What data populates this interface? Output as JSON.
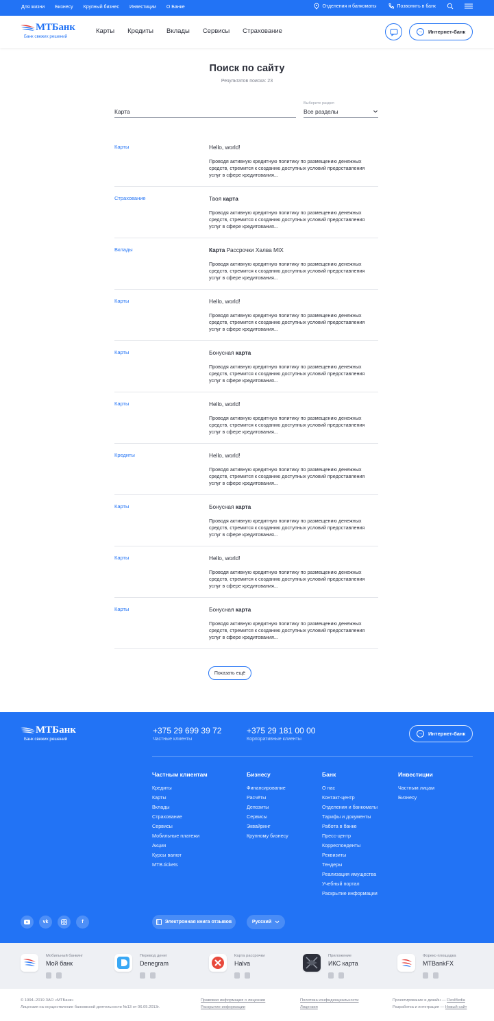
{
  "topbar": {
    "links": [
      "Для жизни",
      "Бизнесу",
      "Крупный бизнес",
      "Инвестиции",
      "О Банке"
    ],
    "branches": "Отделения и банкоматы",
    "call": "Позвонить в банк"
  },
  "header": {
    "logo_text": "МТБанк",
    "logo_slogan": "Банк свежих решений",
    "nav": [
      "Карты",
      "Кредиты",
      "Вклады",
      "Сервисы",
      "Страхование"
    ],
    "internet_bank": "Интернет-банк"
  },
  "search": {
    "title": "Поиск по сайту",
    "count": "Результатов поиска: 23",
    "query": "Карта",
    "section_label": "Выберите раздел",
    "section_value": "Все разделы"
  },
  "results": [
    {
      "category": "Карты",
      "title_pre": "Hello, world!",
      "title_bold": "",
      "title_post": "",
      "desc": "Проводя активную кредитную политику по размещению денежных средств, стремится к созданию доступных условий предоставления услуг в сфере кредитования..."
    },
    {
      "category": "Страхование",
      "title_pre": "Твоя ",
      "title_bold": "карта",
      "title_post": "",
      "desc": "Проводя активную кредитную политику по размещению денежных средств, стремится к созданию доступных условий предоставления услуг в сфере кредитования..."
    },
    {
      "category": "Вклады",
      "title_pre": "",
      "title_bold": "Карта",
      "title_post": " Рассрочки Халва MIX",
      "desc": "Проводя активную кредитную политику по размещению денежных средств, стремится к созданию доступных условий предоставления услуг в сфере кредитования..."
    },
    {
      "category": "Карты",
      "title_pre": "Hello, world!",
      "title_bold": "",
      "title_post": "",
      "desc": "Проводя активную кредитную политику по размещению денежных средств, стремится к созданию доступных условий предоставления услуг в сфере кредитования..."
    },
    {
      "category": "Карты",
      "title_pre": "Бонусная ",
      "title_bold": "карта",
      "title_post": "",
      "desc": "Проводя активную кредитную политику по размещению денежных средств, стремится к созданию доступных условий предоставления услуг в сфере кредитования..."
    },
    {
      "category": "Карты",
      "title_pre": "Hello, world!",
      "title_bold": "",
      "title_post": "",
      "desc": "Проводя активную кредитную политику по размещению денежных средств, стремится к созданию доступных условий предоставления услуг в сфере кредитования..."
    },
    {
      "category": "Кредиты",
      "title_pre": "Hello, world!",
      "title_bold": "",
      "title_post": "",
      "desc": "Проводя активную кредитную политику по размещению денежных средств, стремится к созданию доступных условий предоставления услуг в сфере кредитования..."
    },
    {
      "category": "Карты",
      "title_pre": "Бонусная ",
      "title_bold": "карта",
      "title_post": "",
      "desc": "Проводя активную кредитную политику по размещению денежных средств, стремится к созданию доступных условий предоставления услуг в сфере кредитования..."
    },
    {
      "category": "Карты",
      "title_pre": "Hello, world!",
      "title_bold": "",
      "title_post": "",
      "desc": "Проводя активную кредитную политику по размещению денежных средств, стремится к созданию доступных условий предоставления услуг в сфере кредитования..."
    },
    {
      "category": "Карты",
      "title_pre": "Бонусная ",
      "title_bold": "карта",
      "title_post": "",
      "desc": "Проводя активную кредитную политику по размещению денежных средств, стремится к созданию доступных условий предоставления услуг в сфере кредитования..."
    }
  ],
  "show_more": "Показать ещё",
  "footer": {
    "logo_text": "МТБанк",
    "logo_slogan": "Банк свежих решений",
    "phone1": "+375 29 699 39 72",
    "phone1_sub": "Частные клиенты",
    "phone2": "+375 29 181 00 00",
    "phone2_sub": "Корпоративные клиенты",
    "internet_bank": "Интернет-банк",
    "columns": [
      {
        "title": "Частным клиентам",
        "links": [
          "Кредиты",
          "Карты",
          "Вклады",
          "Страхование",
          "Сервисы",
          "Мобильные платежи",
          "Акции",
          "Курсы валют",
          "MTB.tickets"
        ]
      },
      {
        "title": "Бизнесу",
        "links": [
          "Финансирование",
          "Расчёты",
          "Депозиты",
          "Сервисы",
          "Эквайринг",
          "Крупному бизнесу"
        ]
      },
      {
        "title": "Банк",
        "links": [
          "О нас",
          "Контакт-центр",
          "Отделения и банкоматы",
          "Тарифы и документы",
          "Работа в банке",
          "Пресс-центр",
          "Корреспонденты",
          "Реквизиты",
          "Тендеры",
          "Реализация имущества",
          "Учебный портал",
          "Раскрытие информации"
        ]
      },
      {
        "title": "Инвестиции",
        "links": [
          "Частным лицам",
          "Бизнесу"
        ]
      }
    ],
    "social": [
      "youtube-icon",
      "vk-icon",
      "instagram-icon",
      "facebook-icon"
    ],
    "feedback_book": "Электронная книга отзывов",
    "language": "Русский"
  },
  "apps": [
    {
      "sub": "Мобильный банкинг",
      "name": "Мой банк",
      "color": "#2273f5"
    },
    {
      "sub": "Перевод денег",
      "name": "Denegram",
      "color": "#39a8f5"
    },
    {
      "sub": "Карта рассрочки",
      "name": "Halva",
      "color": "#e8493c"
    },
    {
      "sub": "Приложение",
      "name": "ИКС карта",
      "color": "#2c2f3a"
    },
    {
      "sub": "Форекс-площадка",
      "name": "MTBankFX",
      "color": "#e3342f"
    }
  ],
  "bottom": {
    "copyright": "© 1994–2019 ЗАО «МТБанк»",
    "license": "Лицензия на осуществление банковской деятельности №13 от 06.05.2013г.",
    "legal1": "Правовая информация о лицензии",
    "legal2": "Раскрытие информации",
    "privacy": "Политика конфиденциальности",
    "licence": "Лицензия",
    "design_label": "Проектирование и дизайн — ",
    "design_link": "FlexMedia",
    "dev_label": "Разработка и интеграция — ",
    "dev_link": "Новый сайт"
  },
  "colors": {
    "accent": "#2273f5",
    "text": "#2c2f3a",
    "muted": "#7b7f8c"
  }
}
